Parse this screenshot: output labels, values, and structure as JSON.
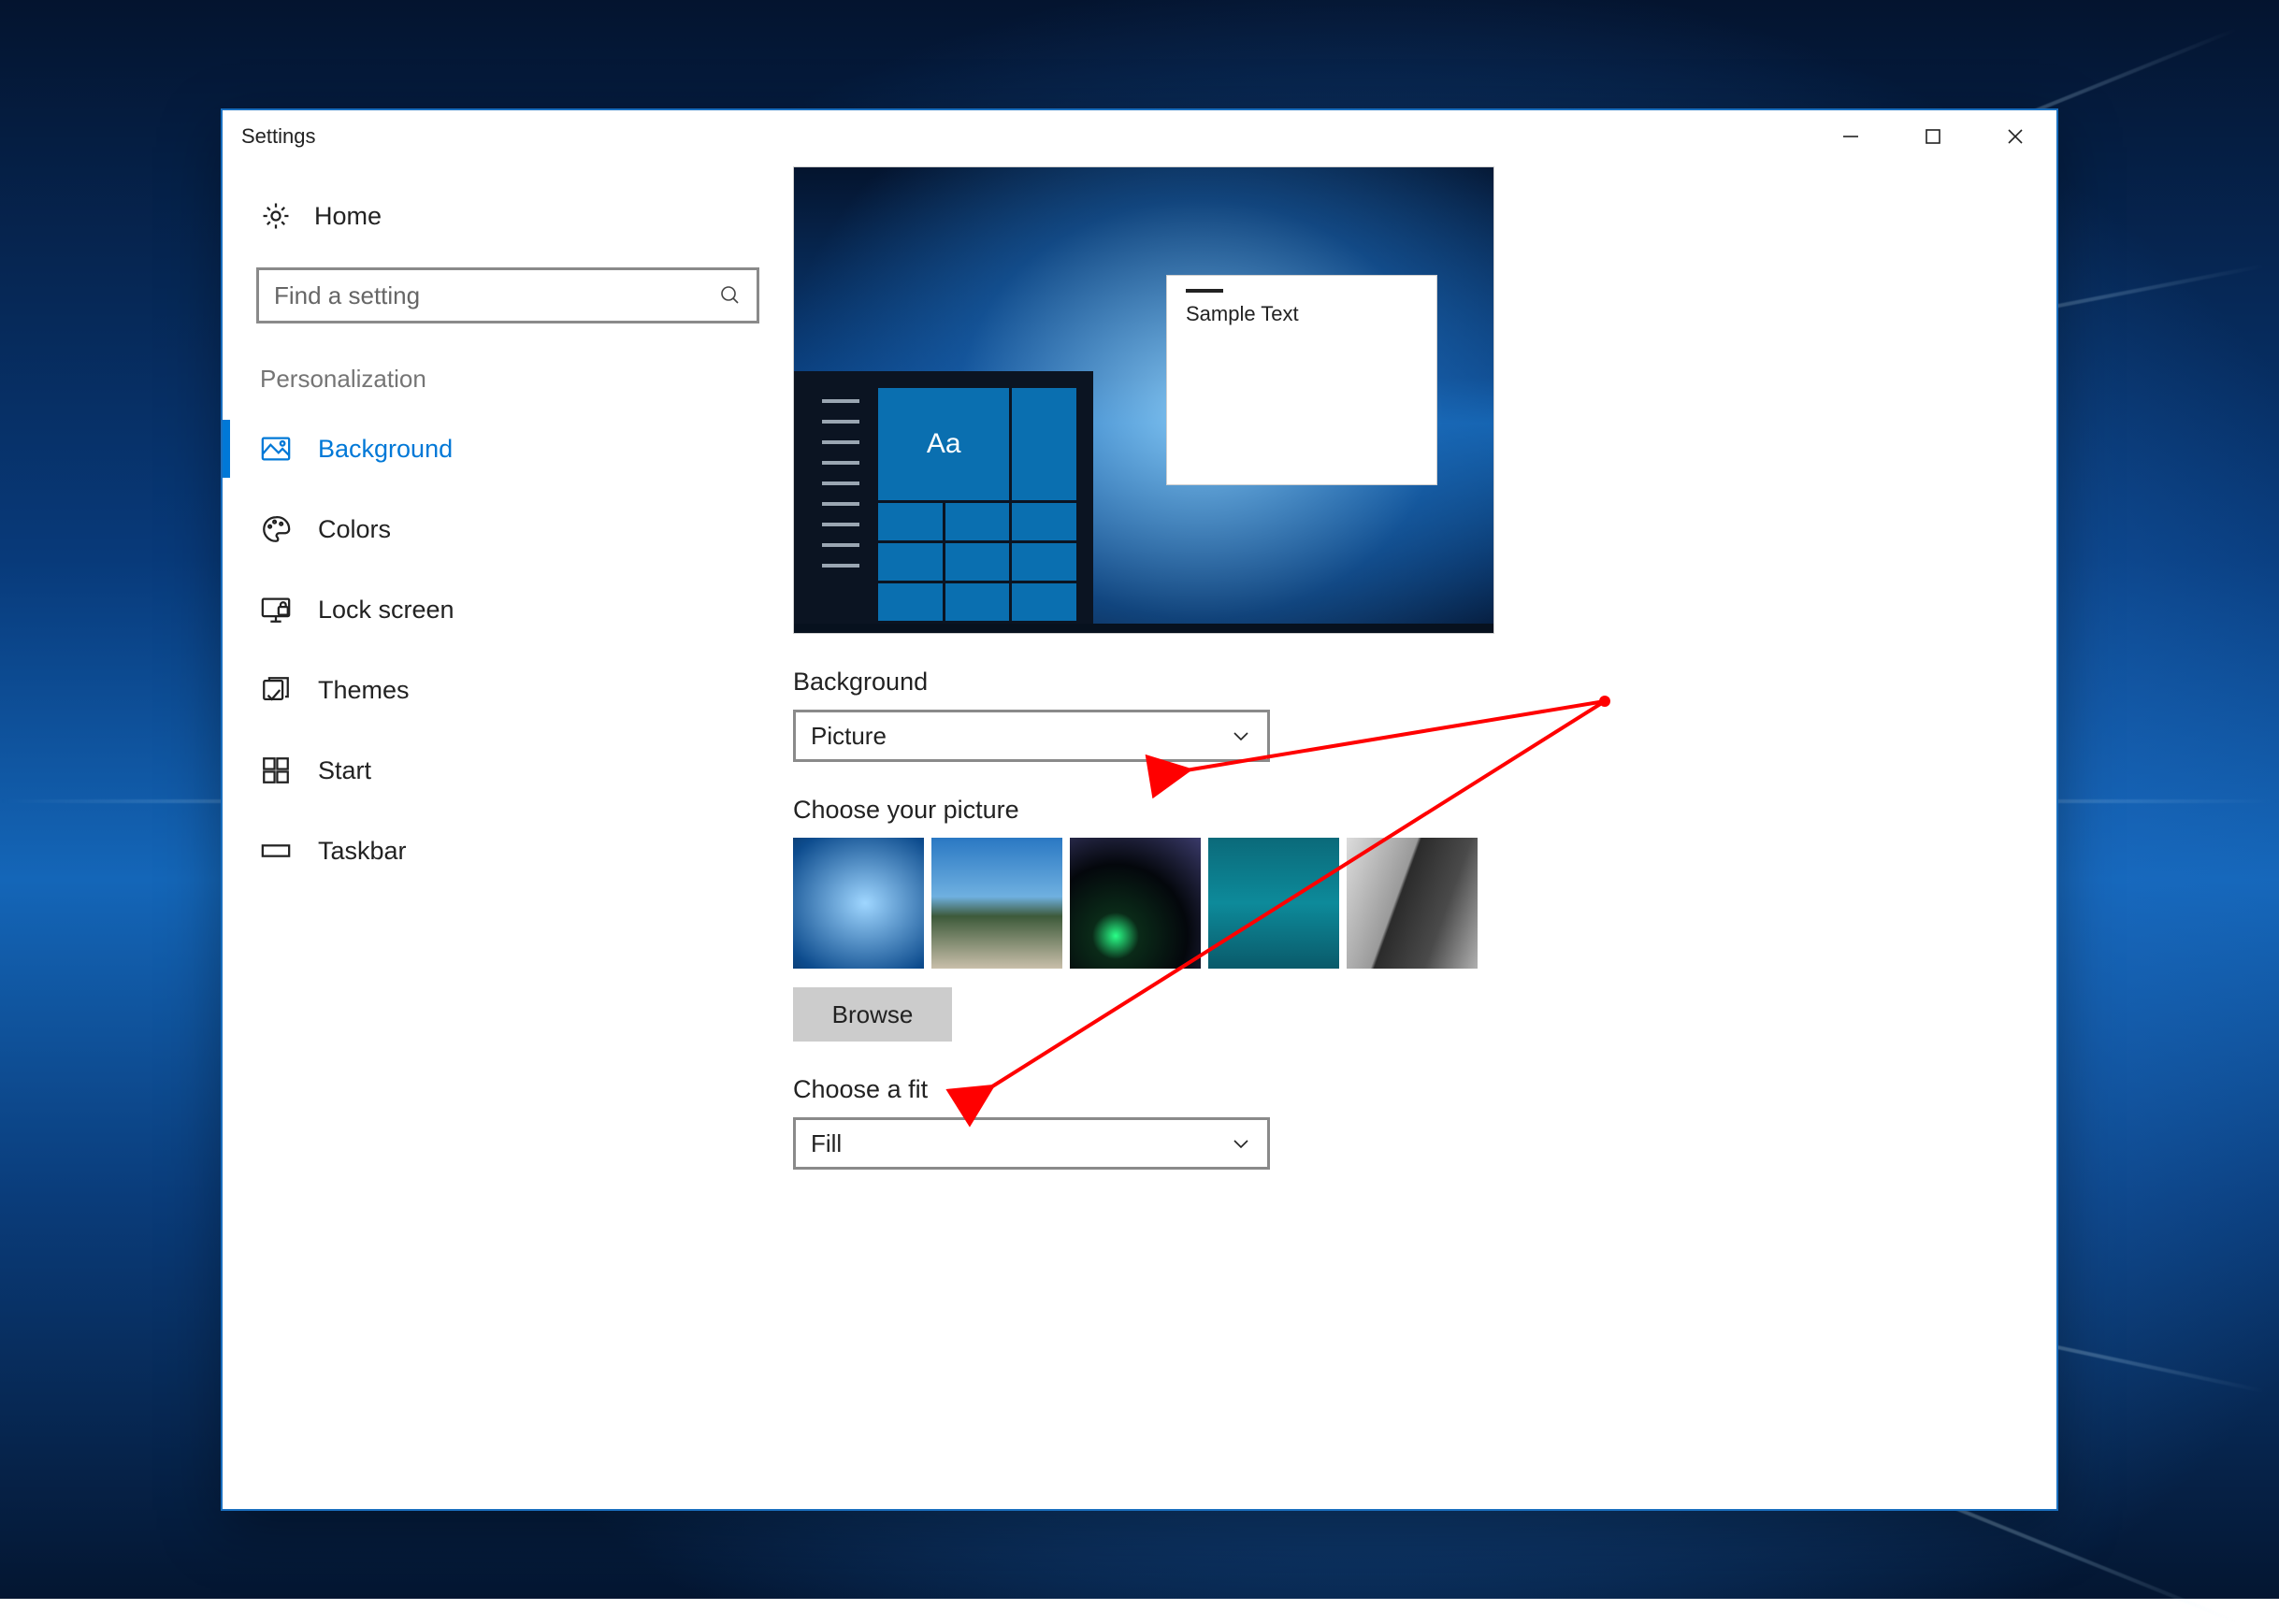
{
  "window": {
    "title": "Settings"
  },
  "sidebar": {
    "home_label": "Home",
    "search_placeholder": "Find a setting",
    "section_label": "Personalization",
    "items": [
      {
        "label": "Background",
        "active": true
      },
      {
        "label": "Colors"
      },
      {
        "label": "Lock screen"
      },
      {
        "label": "Themes"
      },
      {
        "label": "Start"
      },
      {
        "label": "Taskbar"
      }
    ]
  },
  "content": {
    "preview": {
      "sample_text": "Sample Text",
      "tile_text": "Aa"
    },
    "background_label": "Background",
    "background_value": "Picture",
    "choose_picture_label": "Choose your picture",
    "browse_label": "Browse",
    "choose_fit_label": "Choose a fit",
    "fit_value": "Fill"
  }
}
